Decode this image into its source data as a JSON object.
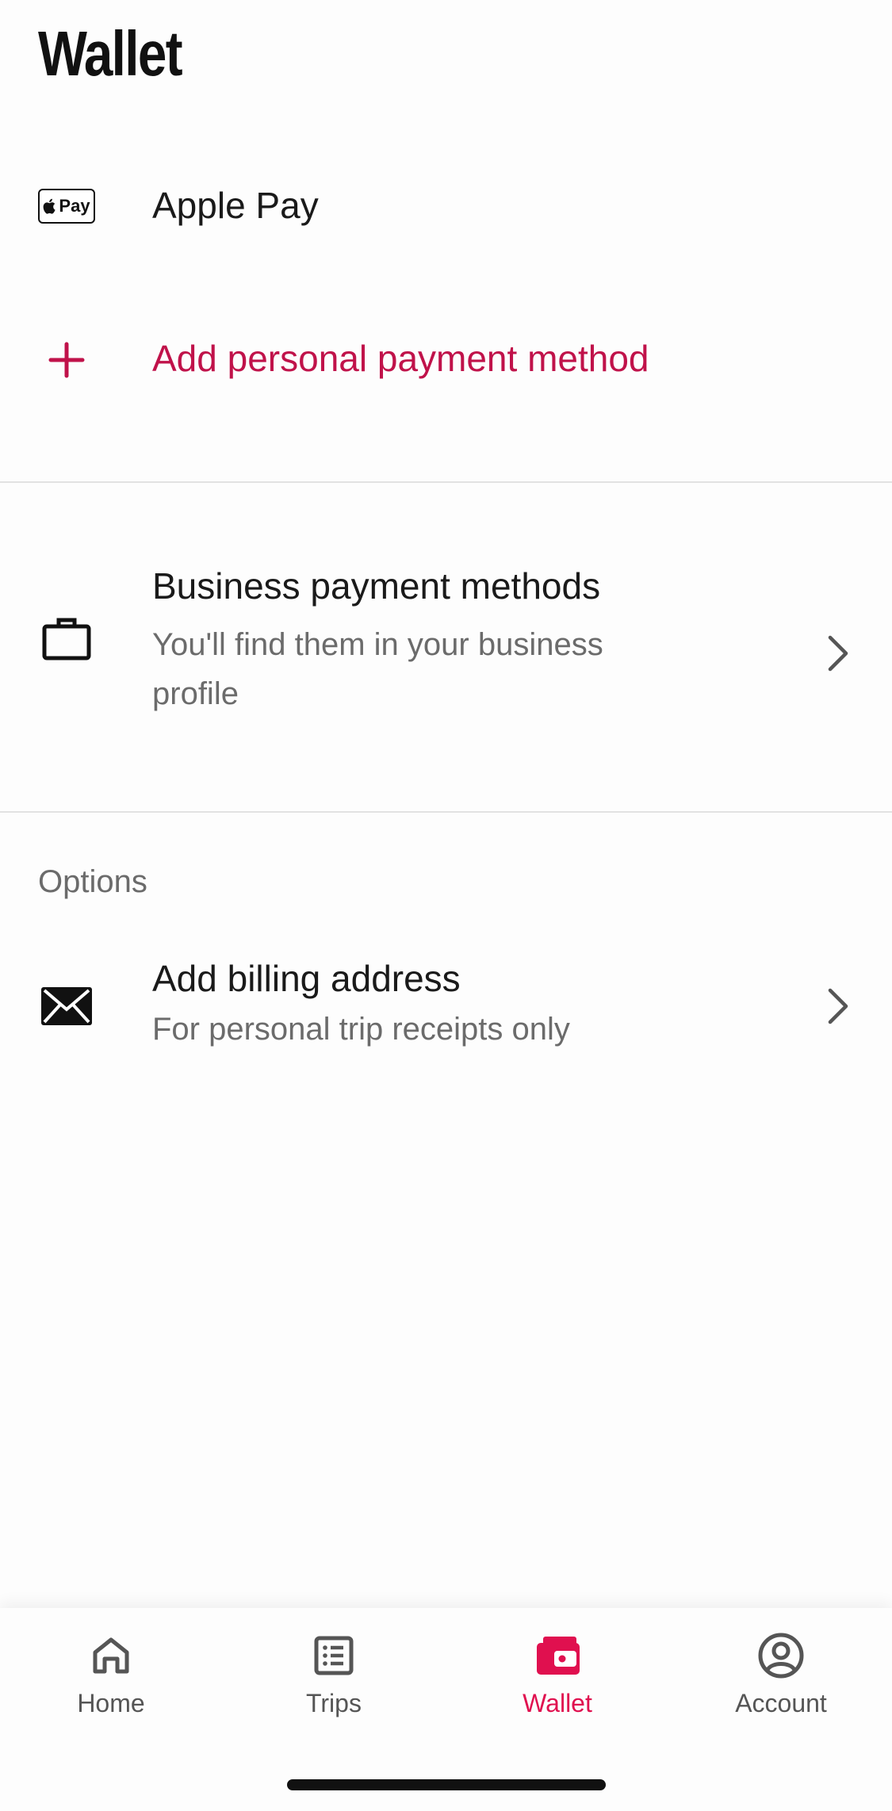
{
  "header": {
    "title": "Wallet"
  },
  "payment_methods": {
    "apple_pay": {
      "badge": "Pay",
      "label": "Apple Pay"
    },
    "add_personal": {
      "label": "Add personal payment method"
    }
  },
  "business": {
    "title": "Business payment methods",
    "subtitle": "You'll find them in your business profile"
  },
  "options": {
    "section_label": "Options",
    "billing": {
      "title": "Add billing address",
      "subtitle": "For personal trip receipts only"
    }
  },
  "bottom_nav": {
    "items": [
      {
        "label": "Home",
        "icon": "home-icon",
        "active": false
      },
      {
        "label": "Trips",
        "icon": "list-icon",
        "active": false
      },
      {
        "label": "Wallet",
        "icon": "wallet-icon",
        "active": true
      },
      {
        "label": "Account",
        "icon": "account-icon",
        "active": false
      }
    ]
  },
  "colors": {
    "accent": "#c0124a",
    "nav_active": "#e0104f",
    "text": "#1a1a1a",
    "subtext": "#6b6b6b"
  }
}
